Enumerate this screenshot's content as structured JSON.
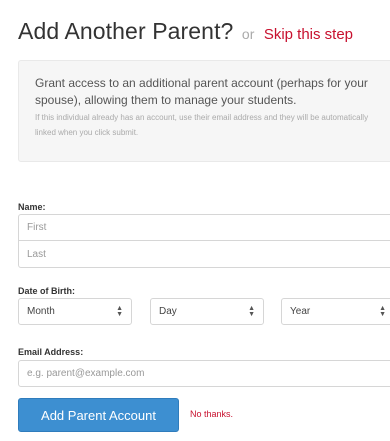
{
  "header": {
    "title": "Add Another Parent?",
    "or": "or",
    "skip_link": "Skip this step"
  },
  "info": {
    "main": "Grant access to an additional parent account (perhaps for your spouse), allowing them to manage your students.",
    "note": "If this individual already has an account, use their email address and they will be automatically linked when you click submit."
  },
  "form": {
    "name_label": "Name:",
    "first_placeholder": "First",
    "last_placeholder": "Last",
    "dob_label": "Date of Birth:",
    "month": "Month",
    "day": "Day",
    "year": "Year",
    "email_label": "Email Address:",
    "email_placeholder": "e.g. parent@example.com"
  },
  "actions": {
    "submit_label": "Add Parent Account",
    "cancel_label": "No thanks."
  }
}
